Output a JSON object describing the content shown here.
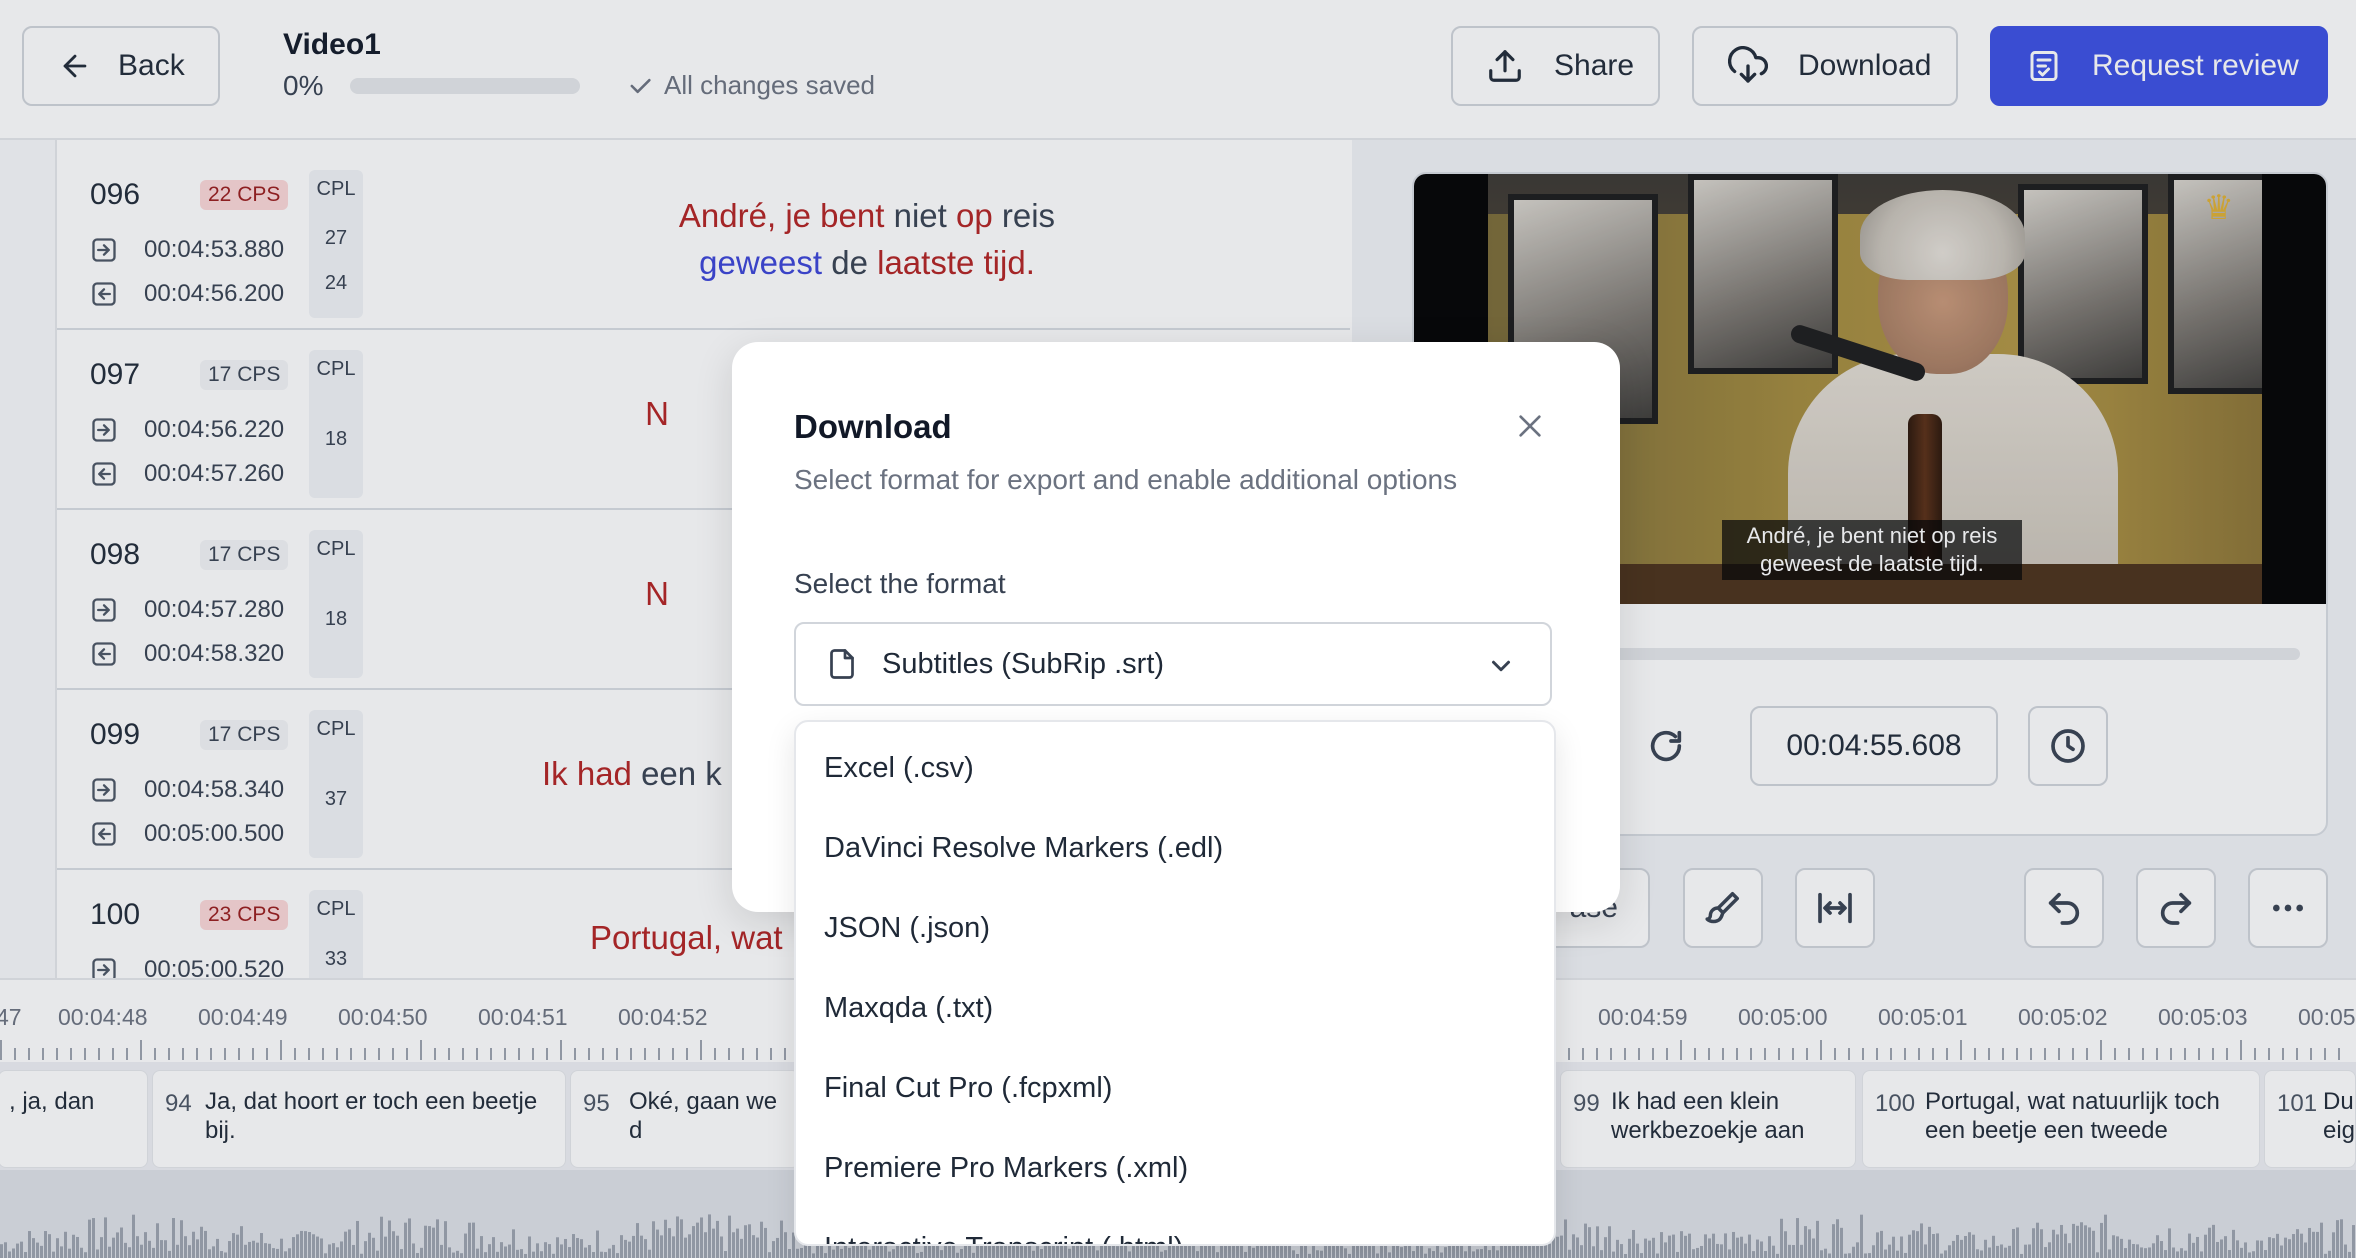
{
  "header": {
    "back_label": "Back",
    "video_title": "Video1",
    "progress_text": "0%",
    "progress_fraction": 0,
    "saved_status": "All changes saved",
    "share_label": "Share",
    "download_label": "Download",
    "review_label": "Request review"
  },
  "subtitles": [
    {
      "num": "096",
      "cps": "22 CPS",
      "cps_warn": true,
      "cpl_label": "CPL",
      "cpl": [
        "27",
        "24"
      ],
      "start": "00:04:53.880",
      "end": "00:04:56.200",
      "line1": [
        [
          "red",
          "André,"
        ],
        [
          "",
          ""
        ],
        [
          "red",
          " je bent"
        ],
        [
          "",
          " niet "
        ],
        [
          "red",
          "op"
        ],
        [
          "",
          " reis"
        ]
      ],
      "line2": [
        [
          "blue",
          "geweest"
        ],
        [
          "",
          " de "
        ],
        [
          "red",
          "laatste tijd."
        ]
      ]
    },
    {
      "num": "097",
      "cps": "17 CPS",
      "cps_warn": false,
      "cpl_label": "CPL",
      "cpl": [
        "18"
      ],
      "start": "00:04:56.220",
      "end": "00:04:57.260",
      "text_visible": "N"
    },
    {
      "num": "098",
      "cps": "17 CPS",
      "cps_warn": false,
      "cpl_label": "CPL",
      "cpl": [
        "18"
      ],
      "start": "00:04:57.280",
      "end": "00:04:58.320",
      "text_visible": "N"
    },
    {
      "num": "099",
      "cps": "17 CPS",
      "cps_warn": false,
      "cpl_label": "CPL",
      "cpl": [
        "37"
      ],
      "start": "00:04:58.340",
      "end": "00:05:00.500",
      "text_visible_red": "Ik had",
      "text_visible_rest": " een k"
    },
    {
      "num": "100",
      "cps": "23 CPS",
      "cps_warn": true,
      "cpl_label": "CPL",
      "cpl": [
        "33"
      ],
      "start": "00:05:00.520",
      "text_visible": "Portugal, wat"
    }
  ],
  "video": {
    "caption_line1": "André, je bent niet op reis",
    "caption_line2": "geweest de laatste tijd.",
    "timecode": "00:04:55.608",
    "release_partial": "ase"
  },
  "timeline": {
    "ticks": [
      "47",
      "00:04:48",
      "00:04:49",
      "00:04:50",
      "00:04:51",
      "00:04:52",
      "00:04:59",
      "00:05:00",
      "00:05:01",
      "00:05:02",
      "00:05:03",
      "00:05"
    ],
    "segments": [
      {
        "num": "",
        "text": ", ja, dan"
      },
      {
        "num": "94",
        "text": "Ja, dat hoort er toch een beetje bij."
      },
      {
        "num": "95",
        "text": "Oké, gaan we d"
      },
      {
        "num": "99",
        "text": "Ik had een klein werkbezoekje aan"
      },
      {
        "num": "100",
        "text": "Portugal, wat natuurlijk toch een beetje een tweede"
      },
      {
        "num": "101",
        "text": "Du eig"
      }
    ]
  },
  "dialog": {
    "title": "Download",
    "subtitle": "Select format for export and enable additional options",
    "select_label": "Select the format",
    "selected_format": "Subtitles (SubRip .srt)",
    "options": [
      "Excel (.csv)",
      "DaVinci Resolve Markers (.edl)",
      "JSON (.json)",
      "Maxqda (.txt)",
      "Final Cut Pro (.fcpxml)",
      "Premiere Pro Markers (.xml)",
      "Interactive Transcript (.html)"
    ]
  },
  "colors": {
    "accent": "#3b4fe4",
    "error_text": "#b32222",
    "warn_badge": "#fcd8d8"
  }
}
